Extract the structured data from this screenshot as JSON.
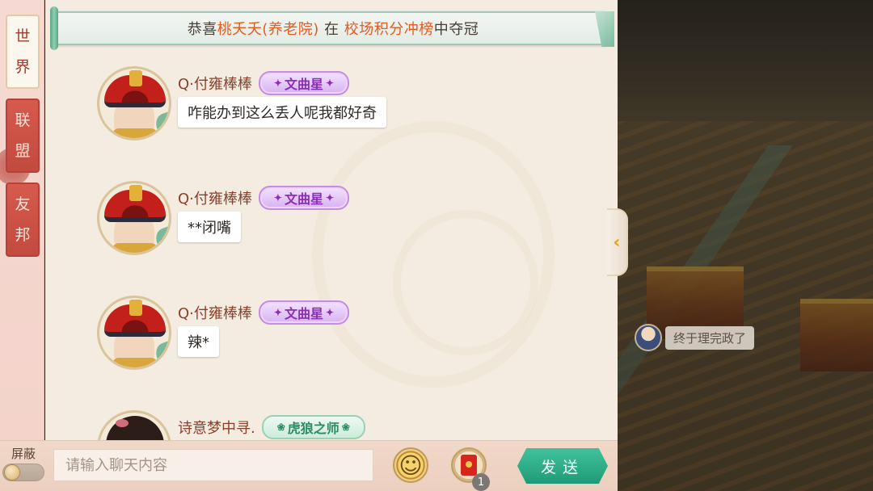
{
  "banner": {
    "prefix": "恭喜",
    "player": "桃夭夭(养老院)",
    "middle": "在",
    "event": "校场积分冲榜",
    "suffix": "中夺冠"
  },
  "tabs": [
    {
      "chars": [
        "世",
        "界"
      ],
      "active": true
    },
    {
      "chars": [
        "联",
        "盟"
      ],
      "active": false
    },
    {
      "chars": [
        "友",
        "邦"
      ],
      "active": false
    }
  ],
  "messages": [
    {
      "username": "Q·付雍棒棒",
      "badge": "文曲星",
      "text": "咋能办到这么丢人呢我都好奇"
    },
    {
      "username": "Q·付雍棒棒",
      "badge": "文曲星",
      "text": "**闭嘴"
    },
    {
      "username": "Q·付雍棒棒",
      "badge": "文曲星",
      "text": "辣*"
    },
    {
      "username": "诗意梦中寻.",
      "badge": "虎狼之师",
      "text": ""
    }
  ],
  "npc": {
    "text": "终于理完政了"
  },
  "bottom": {
    "block_label": "屏蔽",
    "input_placeholder": "请输入聊天内容",
    "redpack_count": "1",
    "send_label": "发送"
  },
  "colors": {
    "highlight": "#e55a1e",
    "tab_active_text": "#a53a2e",
    "tab_inactive_bg": "#d65a4d",
    "send_button": "#2fae88"
  },
  "icons": [
    "emoji-icon",
    "red-envelope-icon",
    "expand-arrow-icon"
  ]
}
